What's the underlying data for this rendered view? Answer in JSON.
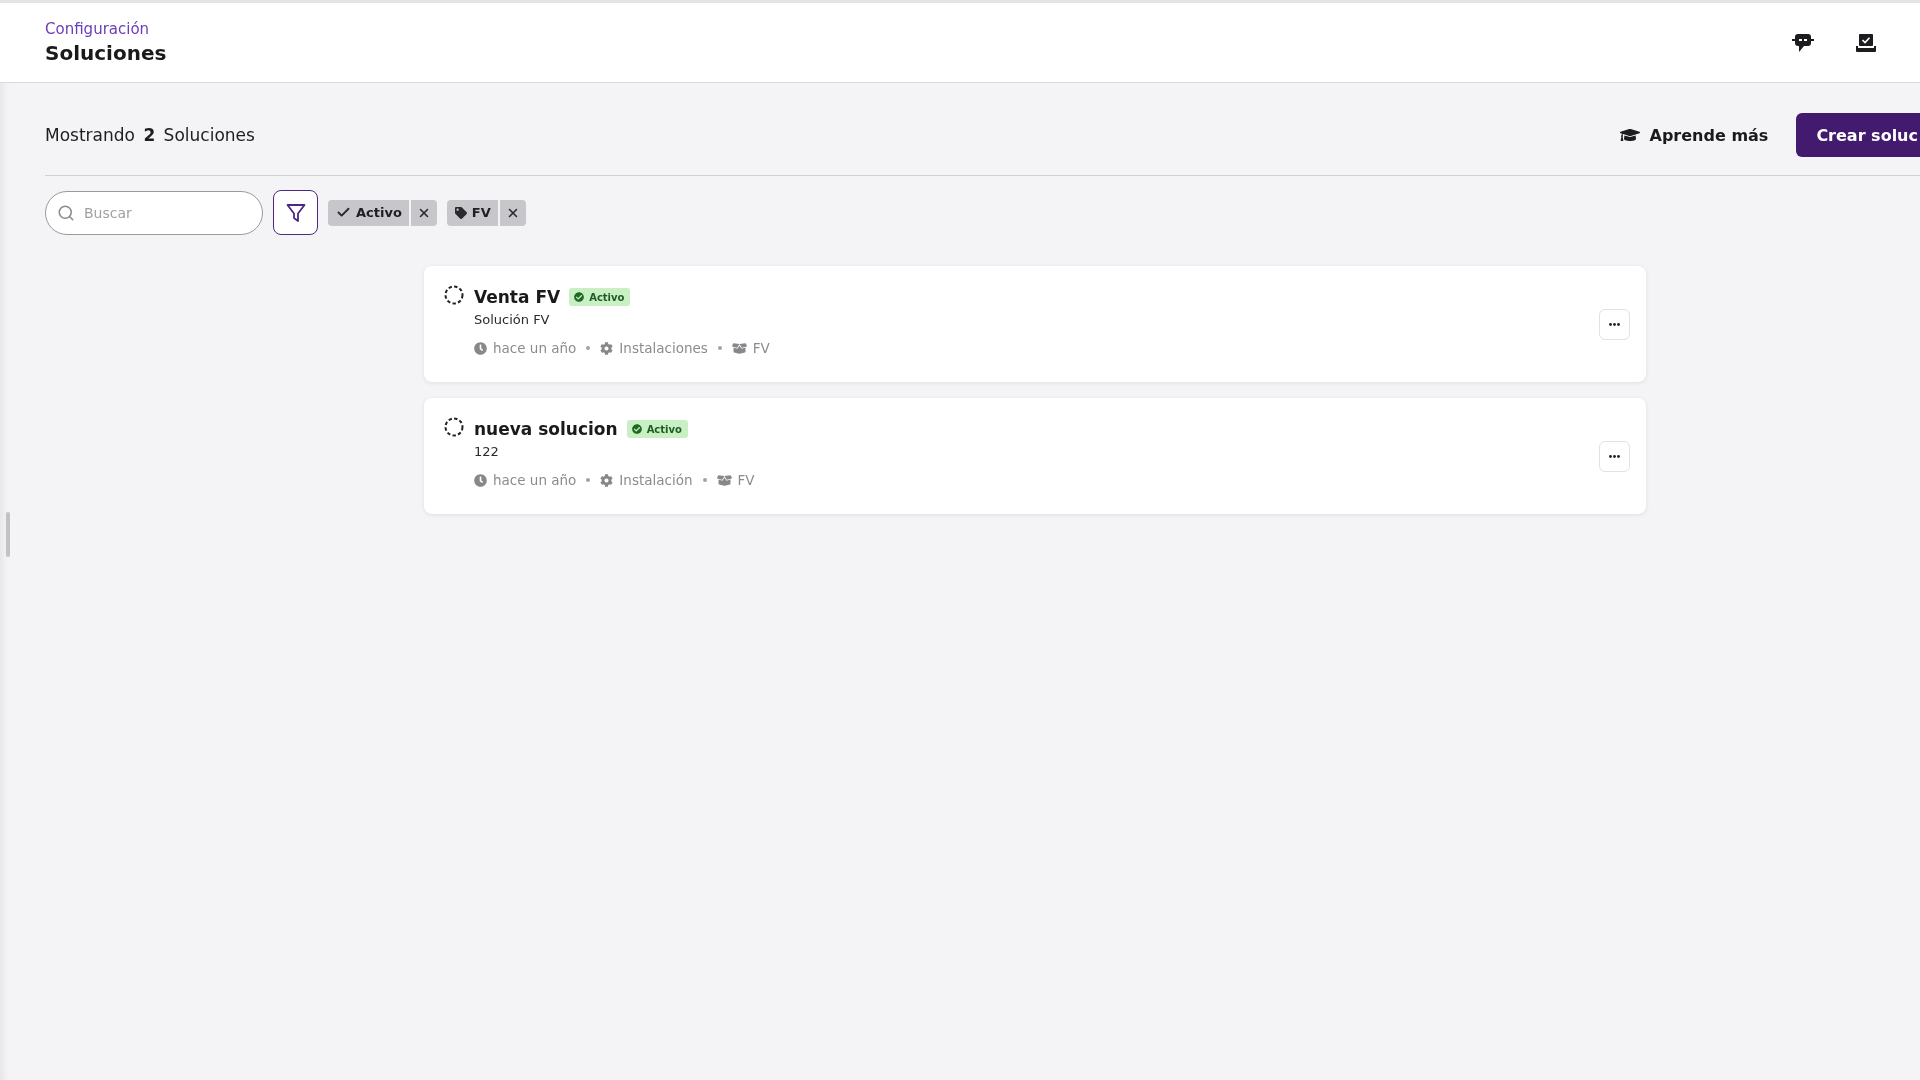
{
  "header": {
    "breadcrumb": "Configuración",
    "title": "Soluciones"
  },
  "summary": "Mostrando **2** Soluciones",
  "actions": [
    {
      "kind": "link",
      "label": "Aprende más"
    },
    {
      "kind": "primary",
      "label": "Crear soluc"
    }
  ],
  "search": {
    "placeholder": "Buscar"
  },
  "filters": [
    {
      "kind": "status",
      "label": "Activo"
    },
    {
      "kind": "tag",
      "label": "FV"
    }
  ],
  "solutions": [
    {
      "title": "Venta FV",
      "status": {
        "kind": "active",
        "label": "Activo"
      },
      "description": "Solución FV",
      "updated": "hace un año",
      "category": "Instalaciones",
      "group": "FV"
    },
    {
      "title": "nueva solucion",
      "status": {
        "kind": "active",
        "label": "Activo"
      },
      "description": "122",
      "updated": "hace un año",
      "category": "Instalación",
      "group": "FV"
    }
  ]
}
